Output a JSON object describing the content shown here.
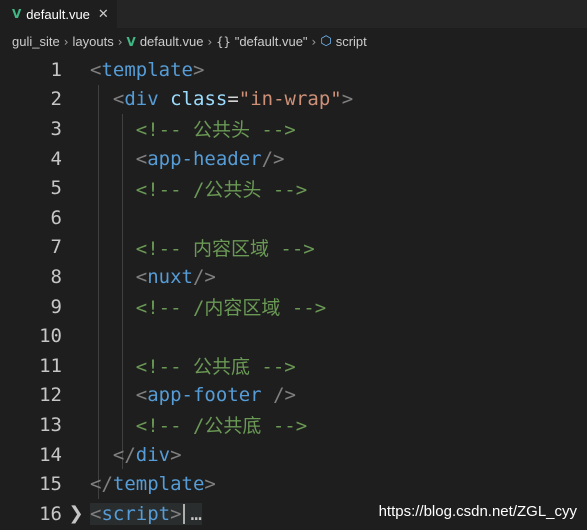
{
  "tab": {
    "filename": "default.vue",
    "vue_icon": "vue-icon",
    "close_glyph": "✕"
  },
  "breadcrumb": {
    "items": [
      "guli_site",
      "layouts",
      "default.vue",
      "\"default.vue\"",
      "script"
    ],
    "braces_glyph": "{}"
  },
  "lines": [
    {
      "n": "1"
    },
    {
      "n": "2"
    },
    {
      "n": "3"
    },
    {
      "n": "4"
    },
    {
      "n": "5"
    },
    {
      "n": "6"
    },
    {
      "n": "7"
    },
    {
      "n": "8"
    },
    {
      "n": "9"
    },
    {
      "n": "10"
    },
    {
      "n": "11"
    },
    {
      "n": "12"
    },
    {
      "n": "13"
    },
    {
      "n": "14"
    },
    {
      "n": "15"
    },
    {
      "n": "16"
    }
  ],
  "code": {
    "template": "template",
    "div": "div",
    "class_attr": "class",
    "class_value": "\"in-wrap\"",
    "c_header_open": "<!-- 公共头 -->",
    "app_header": "app-header",
    "c_header_close": "<!-- /公共头 -->",
    "c_content_open": "<!-- 内容区域 -->",
    "nuxt": "nuxt",
    "c_content_close": "<!-- /内容区域 -->",
    "c_footer_open": "<!-- 公共底 -->",
    "app_footer": "app-footer",
    "c_footer_close": "<!-- /公共底 -->",
    "script": "script",
    "ellipsis": "…"
  },
  "watermark": "https://blog.csdn.net/ZGL_cyy",
  "colors": {
    "background": "#1e1e1e",
    "tag": "#569cd6",
    "attribute": "#9cdcfe",
    "string": "#ce9178",
    "comment": "#6a9955",
    "vue_green": "#41b883"
  }
}
